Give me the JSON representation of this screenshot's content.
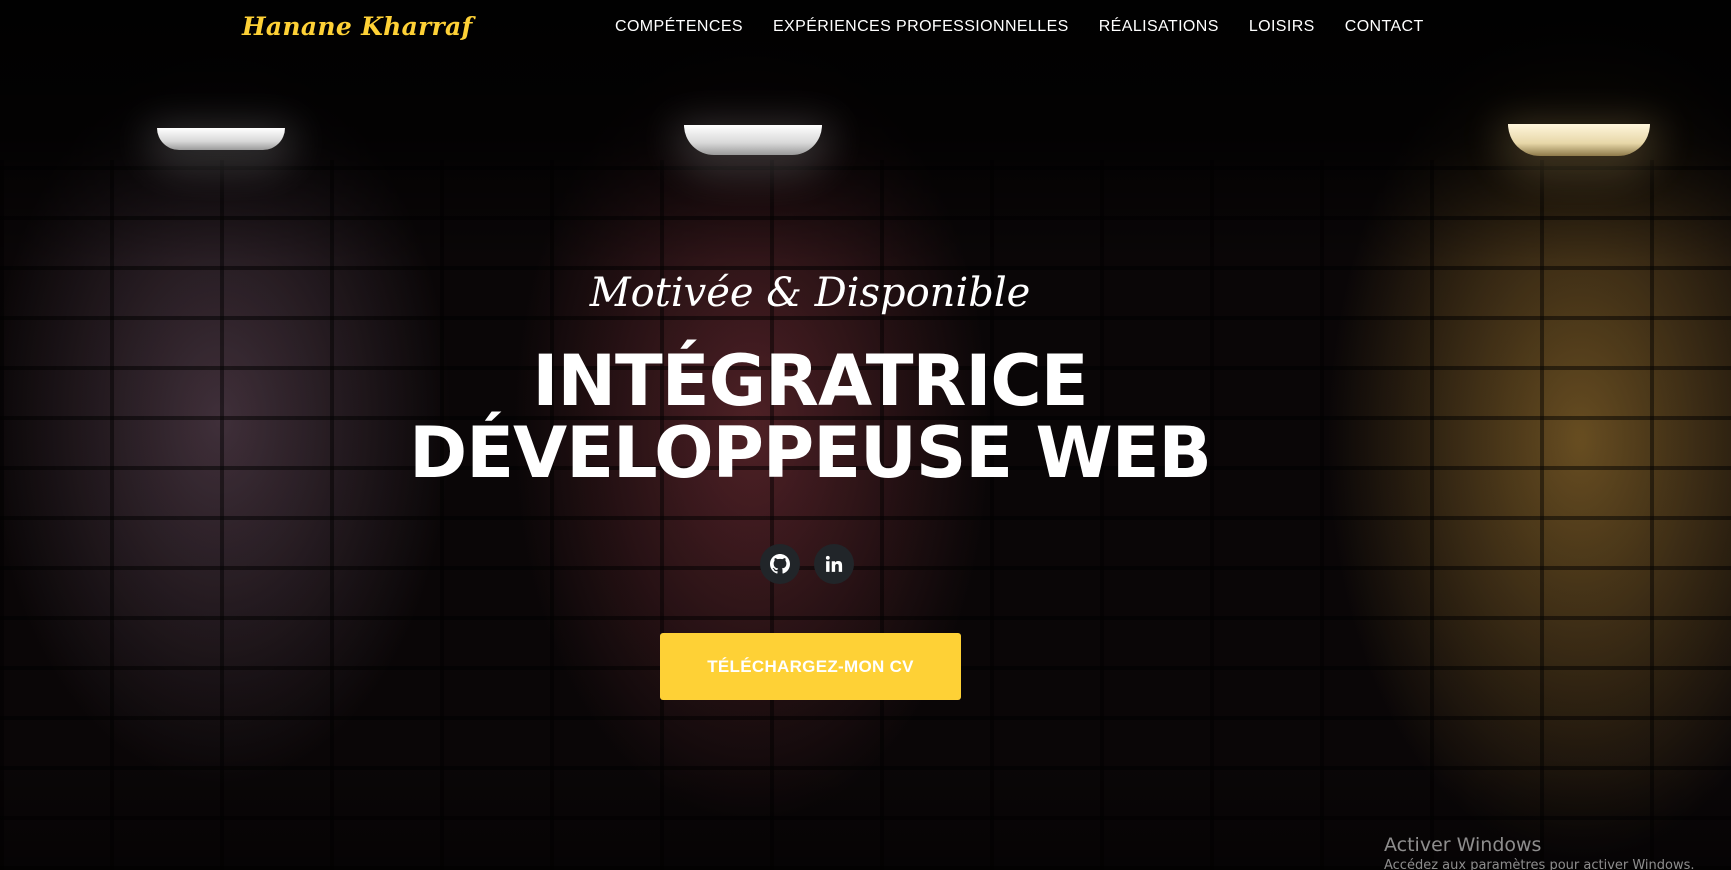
{
  "brand": {
    "name": "Hanane Kharraf",
    "color": "#fed136"
  },
  "nav": {
    "items": [
      {
        "label": "COMPÉTENCES"
      },
      {
        "label": "EXPÉRIENCES PROFESSIONNELLES"
      },
      {
        "label": "RÉALISATIONS"
      },
      {
        "label": "LOISIRS"
      },
      {
        "label": "CONTACT"
      }
    ]
  },
  "hero": {
    "subtitle": "Motivée & Disponible",
    "title_line1": "INTÉGRATRICE",
    "title_line2": "DÉVELOPPEUSE WEB",
    "socials": [
      {
        "icon": "github-icon"
      },
      {
        "icon": "linkedin-icon"
      }
    ],
    "cv_button": "TÉLÉCHARGEZ-MON CV",
    "accent_color": "#fed136"
  },
  "os_watermark": {
    "line1": "Activer Windows",
    "line2": "Accédez aux paramètres pour activer Windows."
  }
}
